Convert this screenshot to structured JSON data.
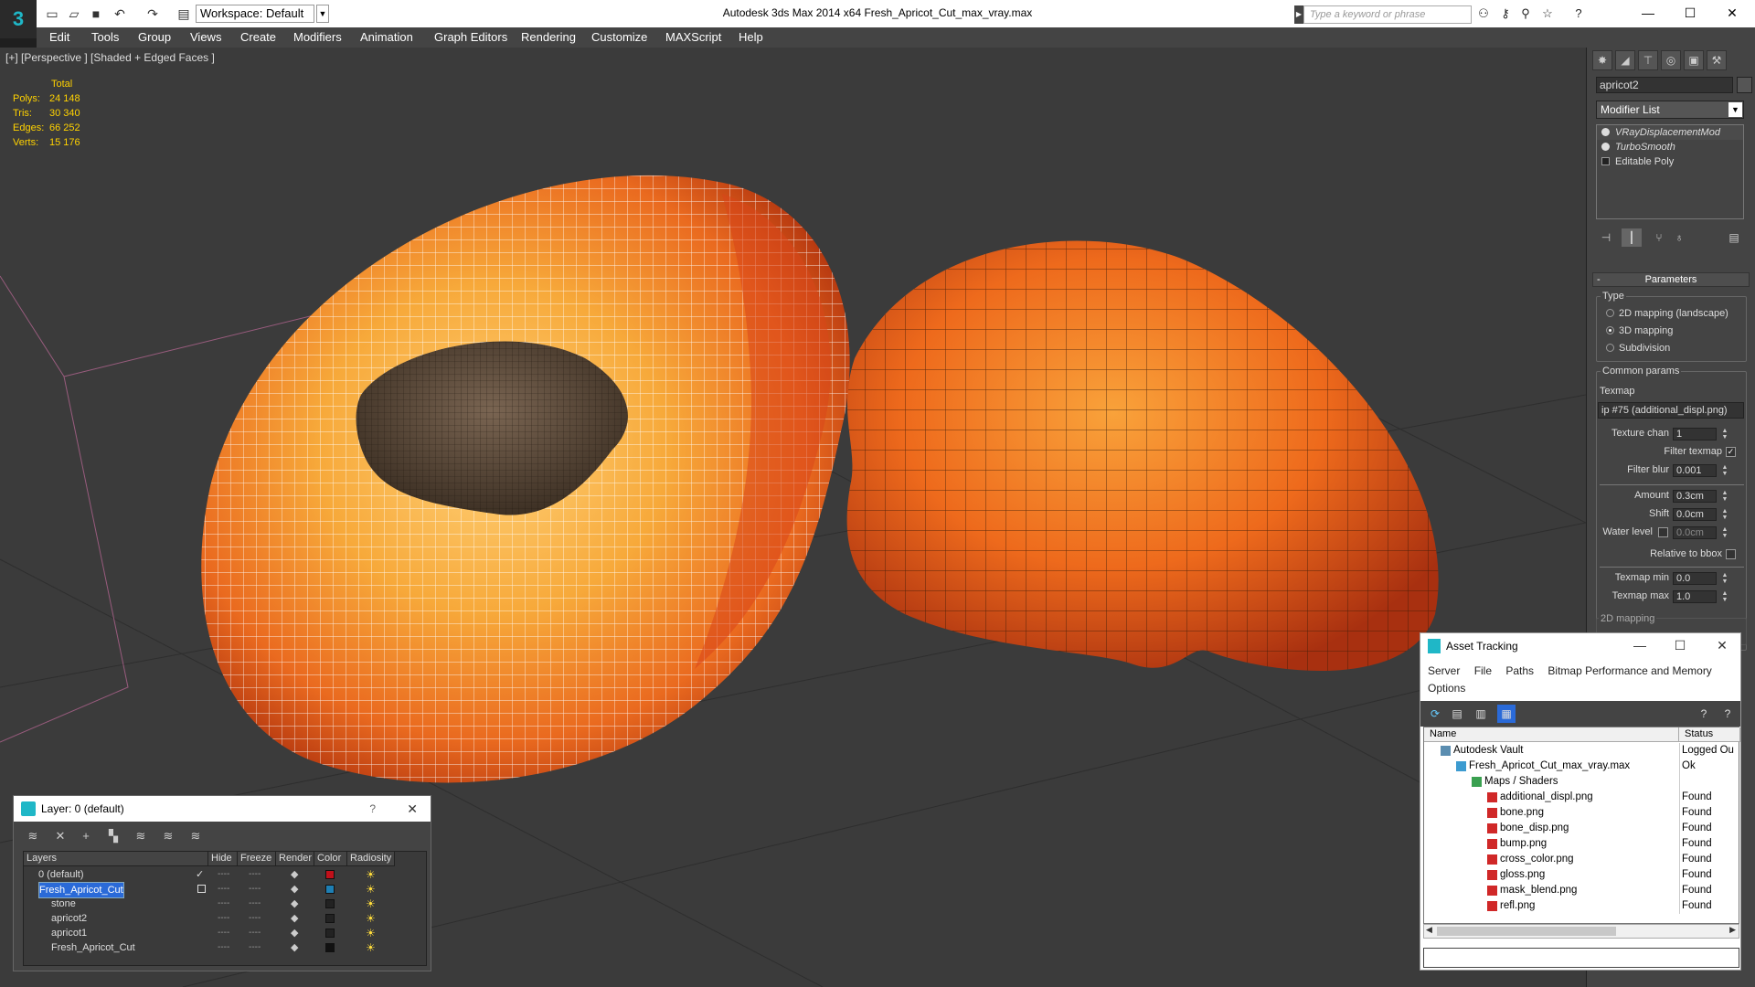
{
  "app": {
    "title": "Autodesk 3ds Max  2014 x64       Fresh_Apricot_Cut_max_vray.max",
    "workspace": "Workspace: Default",
    "search_placeholder": "Type a keyword or phrase",
    "logo": "3"
  },
  "menu": [
    "Edit",
    "Tools",
    "Group",
    "Views",
    "Create",
    "Modifiers",
    "Animation",
    "Graph Editors",
    "Rendering",
    "Customize",
    "MAXScript",
    "Help"
  ],
  "viewport": {
    "label": "[+] [Perspective ] [Shaded + Edged Faces ]",
    "stats_header": "Total",
    "stats": [
      {
        "label": "Polys:",
        "value": "24 148"
      },
      {
        "label": "Tris:",
        "value": "30 340"
      },
      {
        "label": "Edges:",
        "value": "66 252"
      },
      {
        "label": "Verts:",
        "value": "15 176"
      }
    ]
  },
  "command_panel": {
    "object_name": "apricot2",
    "modifier_list": "Modifier List",
    "stack": [
      "VRayDisplacementMod",
      "TurboSmooth",
      "Editable Poly"
    ],
    "params_title": "Parameters",
    "type_label": "Type",
    "type_options": [
      {
        "label": "2D mapping (landscape)",
        "selected": false
      },
      {
        "label": "3D mapping",
        "selected": true
      },
      {
        "label": "Subdivision",
        "selected": false
      }
    ],
    "common_params": "Common params",
    "texmap_label": "Texmap",
    "texmap_value": "ip #75 (additional_displ.png)",
    "texture_chan_label": "Texture chan",
    "texture_chan_value": "1",
    "filter_texmap_label": "Filter texmap",
    "filter_blur_label": "Filter blur",
    "filter_blur_value": "0.001",
    "amount_label": "Amount",
    "amount_value": "0.3cm",
    "shift_label": "Shift",
    "shift_value": "0.0cm",
    "water_label": "Water level",
    "water_value": "0.0cm",
    "relative_label": "Relative to bbox",
    "texmap_min_label": "Texmap min",
    "texmap_min_value": "0.0",
    "texmap_max_label": "Texmap max",
    "texmap_max_value": "1.0",
    "mapping2d": "2D mapping"
  },
  "layer_window": {
    "title": "Layer: 0 (default)",
    "help": "?",
    "columns": [
      "Layers",
      "Hide",
      "Freeze",
      "Render",
      "Color",
      "Radiosity"
    ],
    "rows": [
      {
        "name": "0 (default)",
        "color": "#c0101a",
        "selected": false,
        "indent": 0
      },
      {
        "name": "Fresh_Apricot_Cut",
        "color": "#1e7fb4",
        "selected": true,
        "indent": 0
      },
      {
        "name": "stone",
        "color": "#222222",
        "selected": false,
        "indent": 1
      },
      {
        "name": "apricot2",
        "color": "#222222",
        "selected": false,
        "indent": 1
      },
      {
        "name": "apricot1",
        "color": "#222222",
        "selected": false,
        "indent": 1
      },
      {
        "name": "Fresh_Apricot_Cut",
        "color": "#111111",
        "selected": false,
        "indent": 1
      }
    ]
  },
  "asset_window": {
    "title": "Asset Tracking",
    "menu": [
      "Server",
      "File",
      "Paths",
      "Bitmap Performance and Memory",
      "Options"
    ],
    "columns": [
      "Name",
      "Status"
    ],
    "rows": [
      {
        "name": "Autodesk Vault",
        "status": "Logged Ou",
        "indent": 0,
        "icon": "vault-icon"
      },
      {
        "name": "Fresh_Apricot_Cut_max_vray.max",
        "status": "Ok",
        "indent": 1,
        "icon": "max-file-icon"
      },
      {
        "name": "Maps / Shaders",
        "status": "",
        "indent": 2,
        "icon": "maps-icon"
      },
      {
        "name": "additional_displ.png",
        "status": "Found",
        "indent": 3,
        "icon": "png-icon"
      },
      {
        "name": "bone.png",
        "status": "Found",
        "indent": 3,
        "icon": "png-icon"
      },
      {
        "name": "bone_disp.png",
        "status": "Found",
        "indent": 3,
        "icon": "png-icon"
      },
      {
        "name": "bump.png",
        "status": "Found",
        "indent": 3,
        "icon": "png-icon"
      },
      {
        "name": "cross_color.png",
        "status": "Found",
        "indent": 3,
        "icon": "png-icon"
      },
      {
        "name": "gloss.png",
        "status": "Found",
        "indent": 3,
        "icon": "png-icon"
      },
      {
        "name": "mask_blend.png",
        "status": "Found",
        "indent": 3,
        "icon": "png-icon"
      },
      {
        "name": "refl.png",
        "status": "Found",
        "indent": 3,
        "icon": "png-icon"
      }
    ]
  }
}
